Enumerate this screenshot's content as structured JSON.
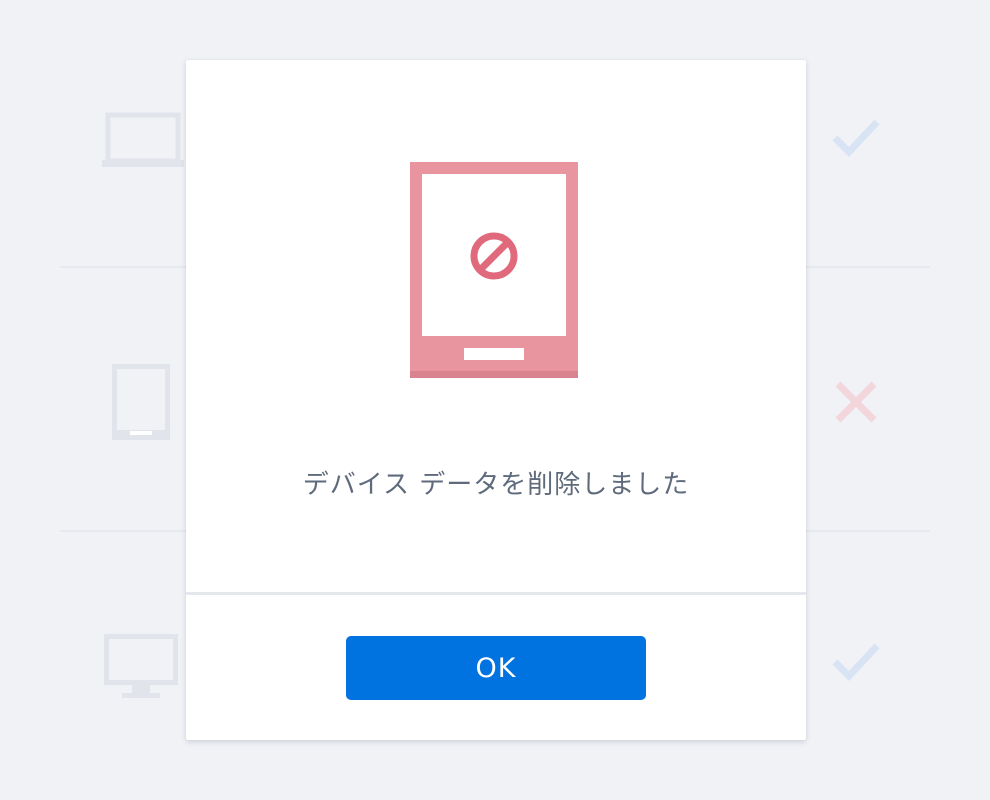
{
  "background_list": {
    "rows": [
      {
        "device_icon": "laptop-icon",
        "status_icon": "checkmark-icon",
        "status_color": "#d8e4f4"
      },
      {
        "device_icon": "tablet-icon",
        "status_icon": "x-mark-icon",
        "status_color": "#f3d6dc"
      },
      {
        "device_icon": "desktop-monitor-icon",
        "status_icon": "checkmark-icon",
        "status_color": "#d8e4f4"
      }
    ],
    "device_icon_color": "#e1e5eb"
  },
  "dialog": {
    "illustration_icon": "tablet-blocked-icon",
    "illustration_color": "#e8959f",
    "block_symbol_color": "#e06a7c",
    "message": "デバイス データを削除しました",
    "ok_label": "OK",
    "ok_color": "#0073e0"
  }
}
